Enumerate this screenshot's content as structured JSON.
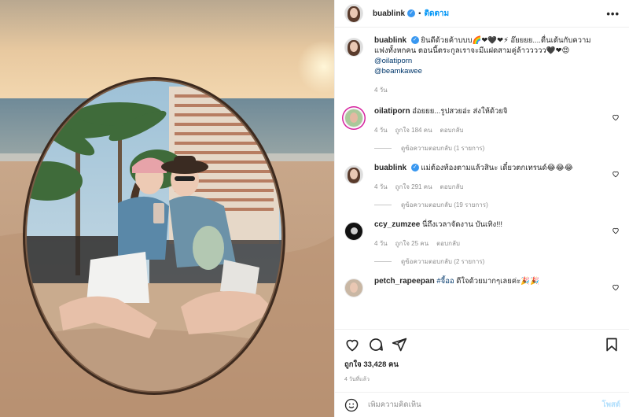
{
  "header": {
    "username": "buablink",
    "follow_label": "ติดตาม",
    "more_label": "•••",
    "dot": "•"
  },
  "caption": {
    "username": "buablink",
    "text": "ยินดีด้วยค้าบบบ🌈❤🖤❤⚡ อ๊ยยยย....ตื่นเต้นกับความแฟงทั้งหกคน ตอนนี้ตระกูลเราจะมีแฝดสามคู่ล้าววววว🖤❤😍 ",
    "mention1": "@oilatiporn",
    "mention2": "@beamkawee",
    "time": "4 วัน"
  },
  "comments": [
    {
      "username": "oilatiporn",
      "text": "อ๋อยยย...รูปสวยอ่ะ ส่งให้ด้วยจิ",
      "time": "4 วัน",
      "likes": "ถูกใจ 184 คน",
      "reply": "ตอบกลับ",
      "view_replies": "ดูข้อความตอบกลับ (1 รายการ)",
      "verified": false
    },
    {
      "username": "buablink",
      "text": "แม่ต้องท้องตามแล้วสินะ เดี๋ยวตกเทรนด์😂😂😂",
      "time": "4 วัน",
      "likes": "ถูกใจ 291 คน",
      "reply": "ตอบกลับ",
      "view_replies": "ดูข้อความตอบกลับ (19 รายการ)",
      "verified": true
    },
    {
      "username": "ccy_zumzee",
      "text": "นี่ถึงเวลาจัดงาน บันเทิง!!!",
      "time": "4 วัน",
      "likes": "ถูกใจ 25 คน",
      "reply": "ตอบกลับ",
      "view_replies": "ดูข้อความตอบกลับ (2 รายการ)",
      "verified": false
    },
    {
      "username": "petch_rapeepan",
      "text": " ดีใจด้วยมากๆเลยค่ะ🎉🎉",
      "tag": "#จี้ออ",
      "verified": false
    }
  ],
  "likes_count": "ถูกใจ 33,428 คน",
  "post_time": "4 วันที่แล้ว",
  "comment_input": {
    "placeholder": "เพิ่มความคิดเห็น",
    "post_label": "โพสต์"
  },
  "colors": {
    "link_blue": "#0095f6",
    "verified_blue": "#3897f0",
    "mention": "#00376b",
    "muted": "#8e8e8e"
  },
  "icons": [
    "heart-icon",
    "comment-icon",
    "share-icon",
    "bookmark-icon",
    "emoji-icon",
    "more-options-icon",
    "verified-badge-icon"
  ]
}
